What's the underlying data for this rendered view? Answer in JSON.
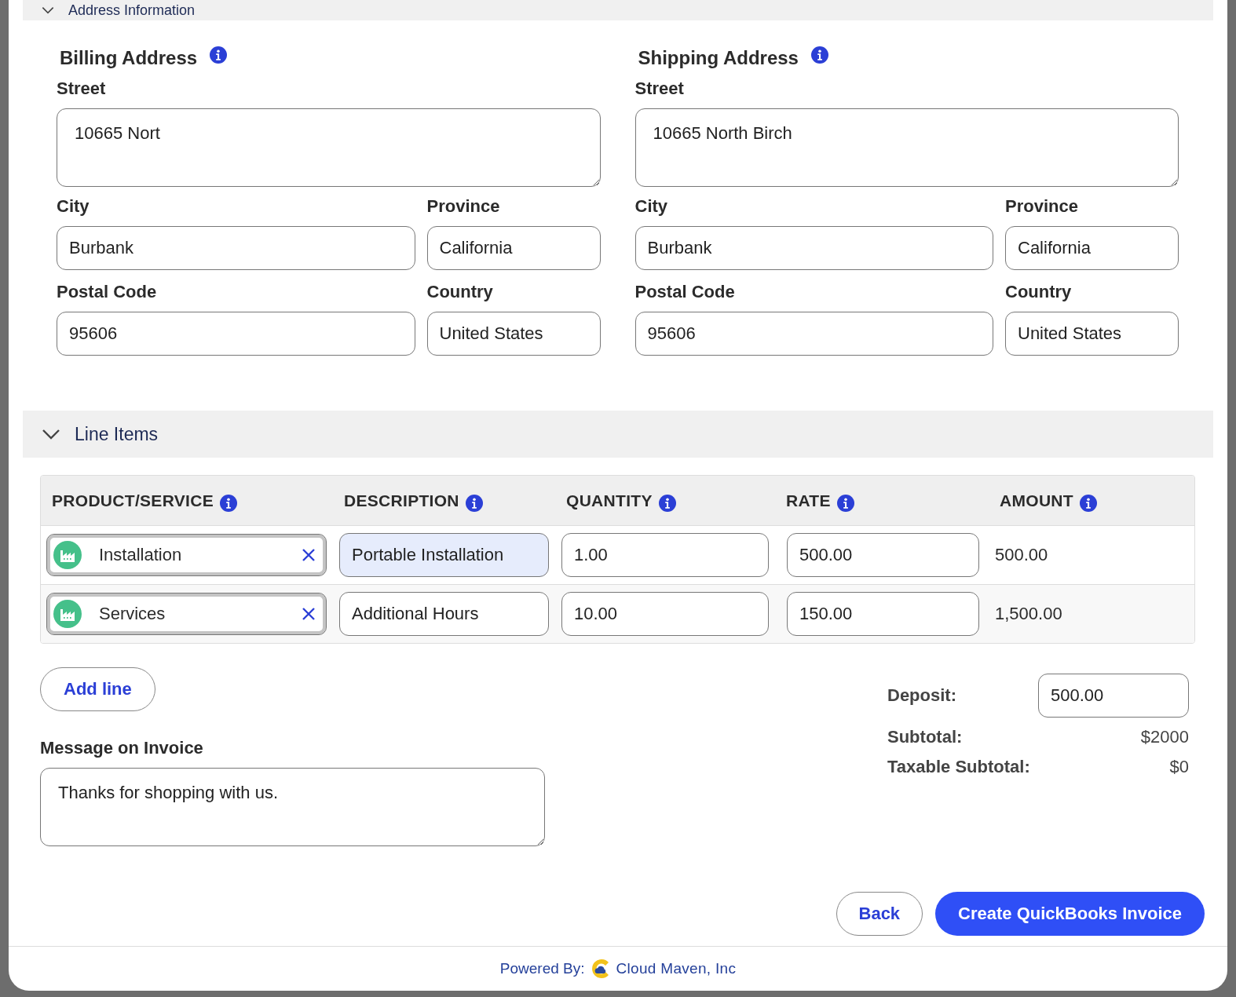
{
  "address_section": {
    "title": "Address Information",
    "expanded": true
  },
  "addresses": [
    {
      "title": "Billing Address",
      "street_label": "Street",
      "street": "10665 Nort",
      "city_label": "City",
      "city": "Burbank",
      "province_label": "Province",
      "province": "California",
      "postal_label": "Postal Code",
      "postal": "95606",
      "country_label": "Country",
      "country": "United States"
    },
    {
      "title": "Shipping Address",
      "street_label": "Street",
      "street": "10665 North Birch",
      "city_label": "City",
      "city": "Burbank",
      "province_label": "Province",
      "province": "California",
      "postal_label": "Postal Code",
      "postal": "95606",
      "country_label": "Country",
      "country": "United States"
    }
  ],
  "line_items": {
    "title": "Line Items",
    "expanded": true,
    "columns": [
      "PRODUCT/SERVICE",
      "DESCRIPTION",
      "QUANTITY",
      "RATE",
      "AMOUNT"
    ],
    "rows": [
      {
        "product": "Installation",
        "description": "Portable Installation",
        "description_focused": true,
        "quantity": "1.00",
        "rate": "500.00",
        "amount": "500.00"
      },
      {
        "product": "Services",
        "description": "Additional Hours",
        "description_focused": false,
        "quantity": "10.00",
        "rate": "150.00",
        "amount": "1,500.00"
      }
    ],
    "add_button": "Add line"
  },
  "message": {
    "label": "Message on Invoice",
    "value": "Thanks for shopping with us."
  },
  "totals": {
    "deposit_label": "Deposit:",
    "deposit": "500.00",
    "subtotal_label": "Subtotal:",
    "subtotal": "$2000",
    "taxable_label": "Taxable Subtotal:",
    "taxable": "$0"
  },
  "buttons": {
    "back": "Back",
    "create": "Create QuickBooks Invoice"
  },
  "footer": {
    "prefix": "Powered By:",
    "company": "Cloud Maven, Inc"
  }
}
